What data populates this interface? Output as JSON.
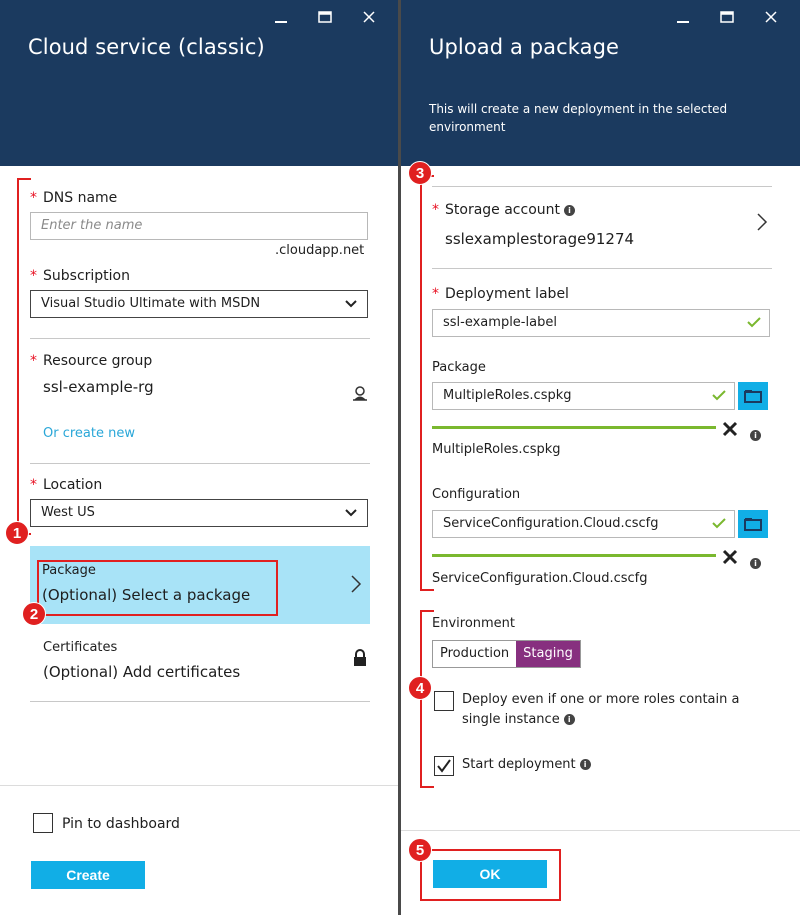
{
  "left": {
    "title": "Cloud service (classic)",
    "dns": {
      "label": "DNS name",
      "placeholder": "Enter the name",
      "suffix": ".cloudapp.net"
    },
    "subscription": {
      "label": "Subscription",
      "value": "Visual Studio Ultimate with MSDN"
    },
    "resource_group": {
      "label": "Resource group",
      "value": "ssl-example-rg",
      "create_link": "Or create new"
    },
    "location": {
      "label": "Location",
      "value": "West US"
    },
    "package": {
      "label": "Package",
      "value": "(Optional) Select a package"
    },
    "certificates": {
      "label": "Certificates",
      "value": "(Optional) Add certificates"
    },
    "pin_label": "Pin to dashboard",
    "create_label": "Create"
  },
  "right": {
    "title": "Upload a package",
    "subtitle": "This will create a new deployment in the selected environment",
    "storage": {
      "label": "Storage account",
      "value": "sslexamplestorage91274"
    },
    "deployment_label": {
      "label": "Deployment label",
      "value": "ssl-example-label"
    },
    "package": {
      "label": "Package",
      "value": "MultipleRoles.cspkg",
      "filename": "MultipleRoles.cspkg"
    },
    "configuration": {
      "label": "Configuration",
      "value": "ServiceConfiguration.Cloud.cscfg",
      "filename": "ServiceConfiguration.Cloud.cscfg"
    },
    "environment": {
      "label": "Environment",
      "options": [
        "Production",
        "Staging"
      ],
      "selected": "Staging"
    },
    "deploy_single_label": "Deploy even if one or more roles contain a single instance",
    "deploy_single_checked": false,
    "start_deployment_label": "Start deployment",
    "start_deployment_checked": true,
    "ok_label": "OK"
  },
  "annotations": [
    "1",
    "2",
    "3",
    "4",
    "5"
  ],
  "colors": {
    "header": "#1b3a5f",
    "accent": "#11aee6",
    "selected_row": "#a8e3f7",
    "staging": "#87307f",
    "annotation": "#e02020",
    "valid": "#7ab82f"
  }
}
